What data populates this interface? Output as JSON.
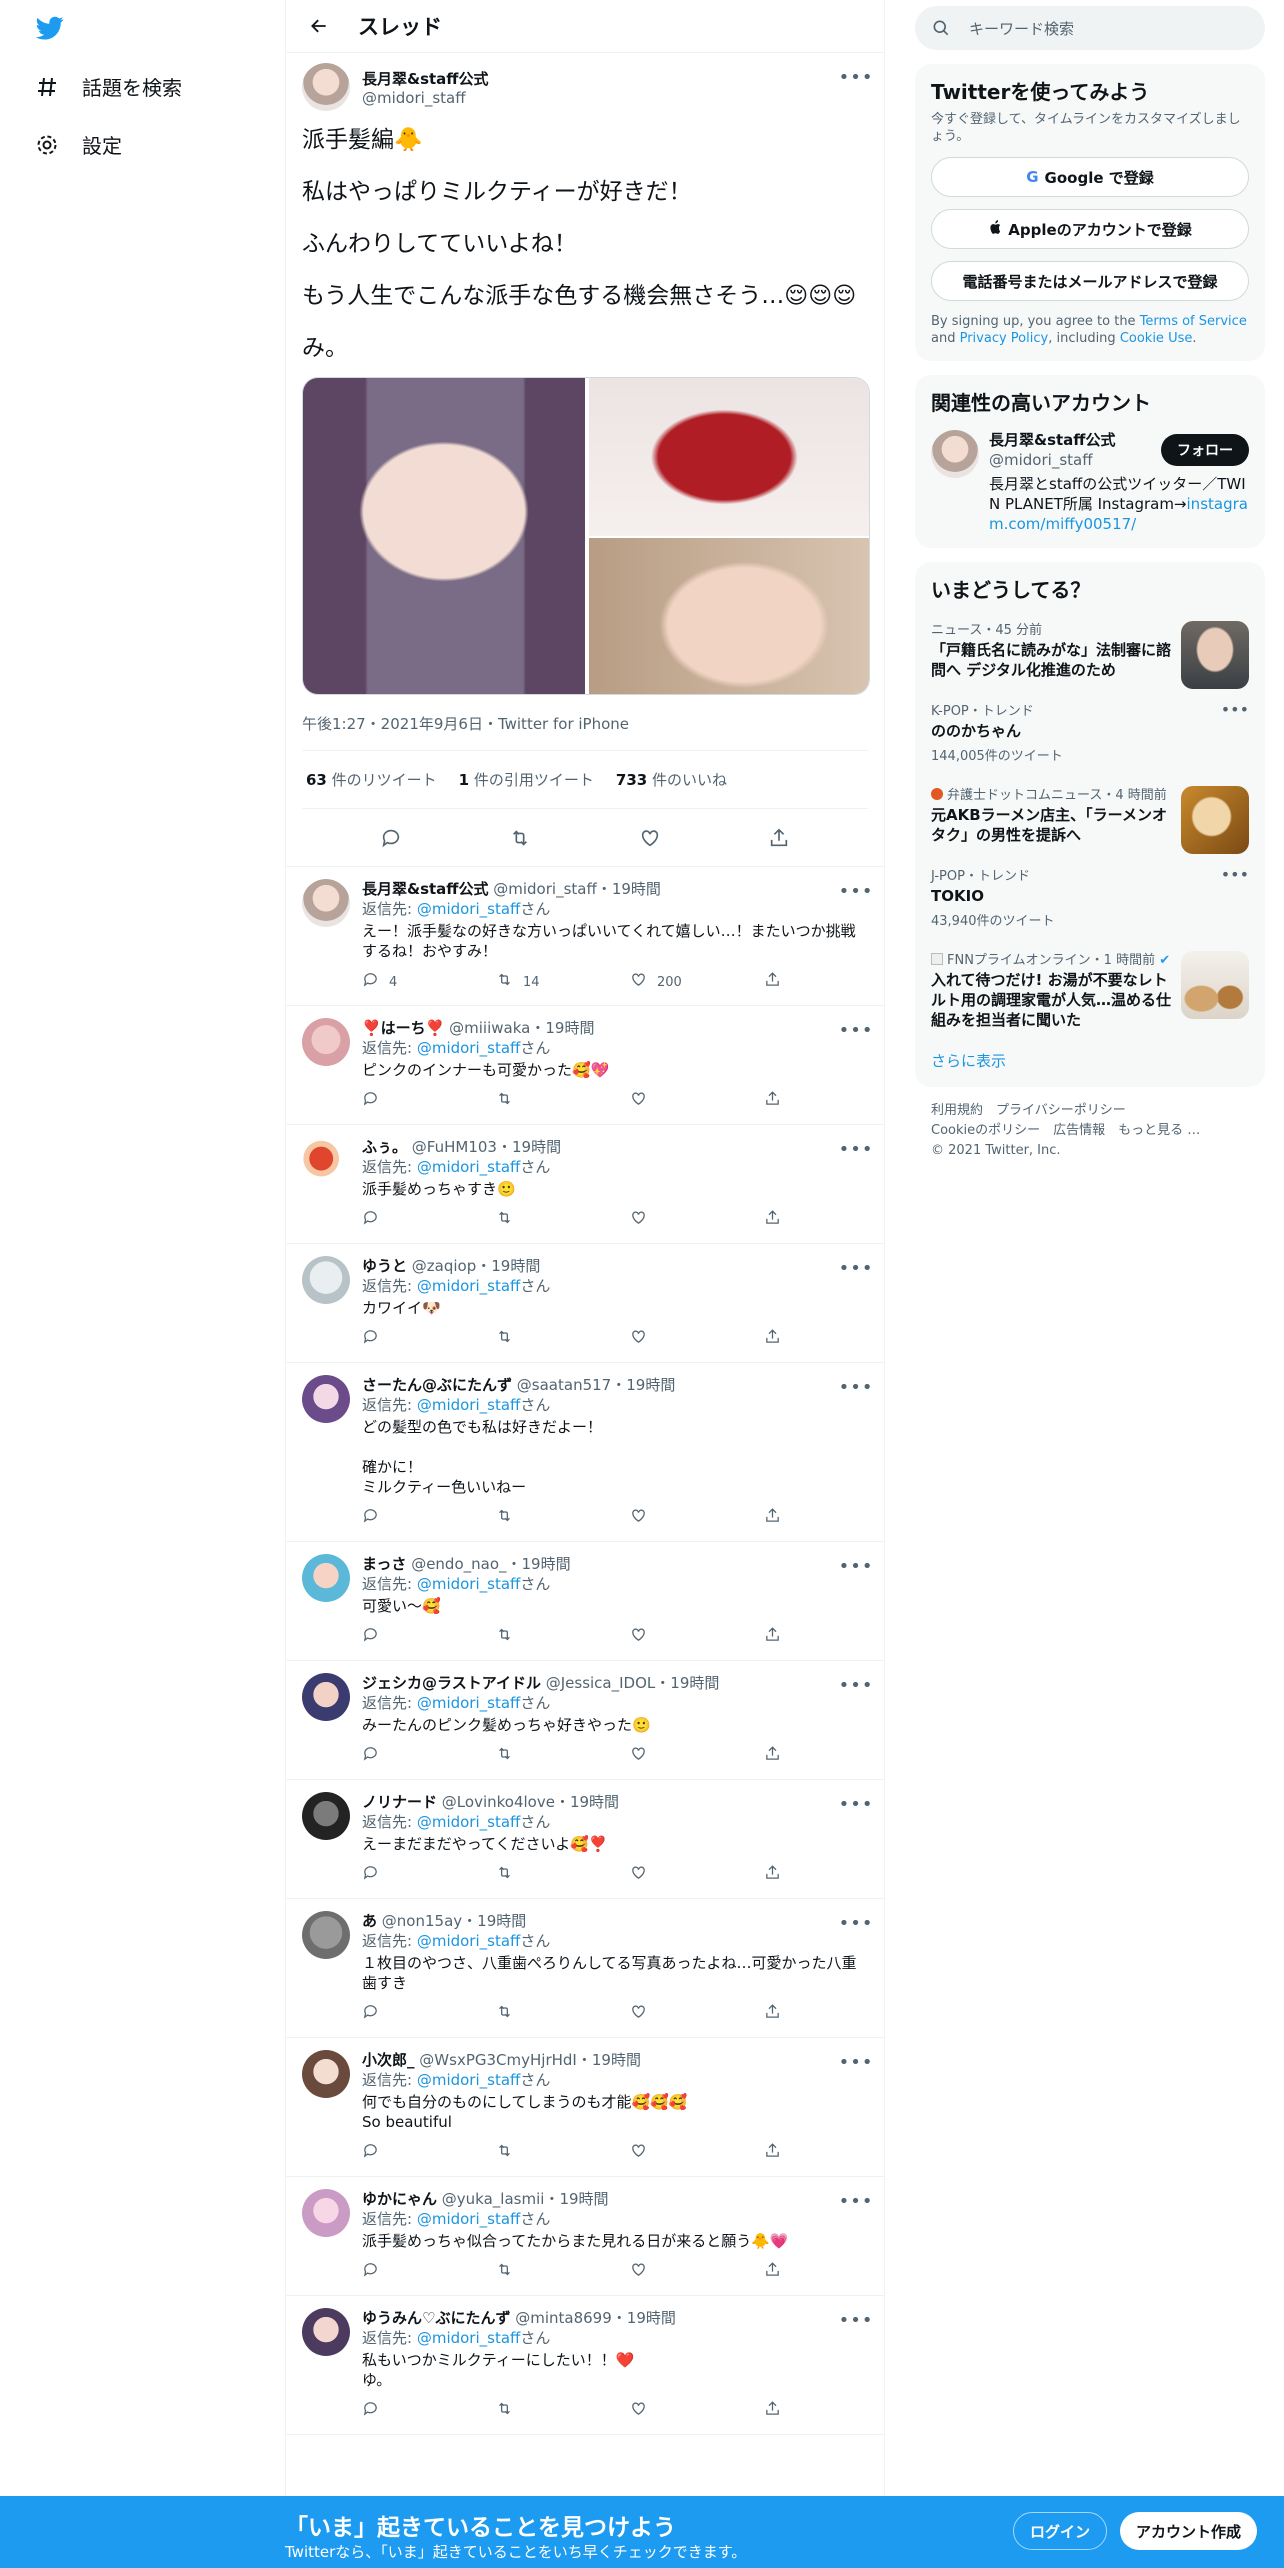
{
  "colors": {
    "accent": "#1d9bf0",
    "link": "#1b95e0",
    "text": "#0f1419",
    "muted": "#536471"
  },
  "nav": {
    "logo_icon": "twitter-bird-icon",
    "items": [
      {
        "icon": "hashtag-icon",
        "label": "話題を検索"
      },
      {
        "icon": "gear-icon",
        "label": "設定"
      }
    ]
  },
  "header": {
    "back_icon": "arrow-left-icon",
    "title": "スレッド"
  },
  "tweet": {
    "name": "長月翠&staff公式",
    "handle": "@midori_staff",
    "paragraphs": [
      "派手髪編🐥",
      "私はやっぱりミルクティーが好きだ！",
      "ふんわりしてていいよね！",
      "もう人生でこんな派手な色する機会無さそう…😌😌😌",
      "み。"
    ],
    "meta": "午後1:27・2021年9月6日・Twitter for iPhone",
    "retweets_num": "63",
    "retweets_label": "件のリツイート",
    "quotes_num": "1",
    "quotes_label": "件の引用ツイート",
    "likes_num": "733",
    "likes_label": "件のいいね"
  },
  "replies": [
    {
      "name": "長月翠&staff公式",
      "handle": "@midori_staff",
      "time": "19時間",
      "to_label": "返信先: ",
      "to_handle": "@midori_staff",
      "to_suffix": "さん",
      "text": "えー！派手髪なの好きな方いっぱいいてくれて嬉しい…！またいつか挑戦するね！おやすみ！",
      "replies": "4",
      "retweets": "14",
      "likes": "200"
    },
    {
      "name": "❣️はーち❣️",
      "handle": "@miiiwaka",
      "time": "19時間",
      "to_label": "返信先: ",
      "to_handle": "@midori_staff",
      "to_suffix": "さん",
      "text": "ピンクのインナーも可愛かった🥰💖",
      "replies": "",
      "retweets": "",
      "likes": ""
    },
    {
      "name": "ふぅ。",
      "handle": "@FuHM103",
      "time": "19時間",
      "to_label": "返信先: ",
      "to_handle": "@midori_staff",
      "to_suffix": "さん",
      "text": "派手髪めっちゃすき🙂",
      "replies": "",
      "retweets": "",
      "likes": ""
    },
    {
      "name": "ゆうと",
      "handle": "@zaqiop",
      "time": "19時間",
      "to_label": "返信先: ",
      "to_handle": "@midori_staff",
      "to_suffix": "さん",
      "text": "カワイイ🐶",
      "replies": "",
      "retweets": "",
      "likes": ""
    },
    {
      "name": "さーたん@ぶにたんず",
      "handle": "@saatan517",
      "time": "19時間",
      "to_label": "返信先: ",
      "to_handle": "@midori_staff",
      "to_suffix": "さん",
      "text": "どの髪型の色でも私は好きだよー！\n\n確かに！\nミルクティー色いいねー",
      "replies": "",
      "retweets": "",
      "likes": ""
    },
    {
      "name": "まっさ",
      "handle": "@endo_nao_",
      "time": "19時間",
      "to_label": "返信先: ",
      "to_handle": "@midori_staff",
      "to_suffix": "さん",
      "text": "可愛い〜🥰",
      "replies": "",
      "retweets": "",
      "likes": ""
    },
    {
      "name": "ジェシカ@ラストアイドル",
      "handle": "@Jessica_IDOL",
      "time": "19時間",
      "to_label": "返信先: ",
      "to_handle": "@midori_staff",
      "to_suffix": "さん",
      "text": "みーたんのピンク髪めっちゃ好きやった🙂",
      "replies": "",
      "retweets": "",
      "likes": ""
    },
    {
      "name": "ノリナード",
      "handle": "@Lovinko4love",
      "time": "19時間",
      "to_label": "返信先: ",
      "to_handle": "@midori_staff",
      "to_suffix": "さん",
      "text": "えーまだまだやってくださいよ🥰❣️",
      "replies": "",
      "retweets": "",
      "likes": ""
    },
    {
      "name": "あ",
      "handle": "@non15ay",
      "time": "19時間",
      "to_label": "返信先: ",
      "to_handle": "@midori_staff",
      "to_suffix": "さん",
      "text": "１枚目のやつさ、八重歯ぺろりんしてる写真あったよね…可愛かった八重歯すき",
      "replies": "",
      "retweets": "",
      "likes": ""
    },
    {
      "name": "小次郎_",
      "handle": "@WsxPG3CmyHjrHdI",
      "time": "19時間",
      "to_label": "返信先: ",
      "to_handle": "@midori_staff",
      "to_suffix": "さん",
      "text": "何でも自分のものにしてしまうのも才能🥰🥰🥰\nSo beautiful",
      "replies": "",
      "retweets": "",
      "likes": ""
    },
    {
      "name": "ゆかにゃん",
      "handle": "@yuka_lasmii",
      "time": "19時間",
      "to_label": "返信先: ",
      "to_handle": "@midori_staff",
      "to_suffix": "さん",
      "text": "派手髪めっちゃ似合ってたからまた見れる日が来ると願う🐥💗",
      "replies": "",
      "retweets": "",
      "likes": ""
    },
    {
      "name": "ゆうみん♡ぶにたんず",
      "handle": "@minta8699",
      "time": "19時間",
      "to_label": "返信先: ",
      "to_handle": "@midori_staff",
      "to_suffix": "さん",
      "text": "私もいつかミルクティーにしたい！！❤️\nゆ。",
      "replies": "",
      "retweets": "",
      "likes": ""
    }
  ],
  "search": {
    "placeholder": "キーワード検索"
  },
  "signup_card": {
    "title": "Twitterを使ってみよう",
    "subtitle": "今すぐ登録して、タイムラインをカスタマイズしましょう。",
    "google_btn": "Google で登録",
    "apple_btn": "Appleのアカウントで登録",
    "phone_btn": "電話番号またはメールアドレスで登録",
    "legal_pre": "By signing up, you agree to the ",
    "tos": "Terms of Service",
    "and": " and ",
    "privacy": "Privacy Policy",
    "including": ", including ",
    "cookie": "Cookie Use",
    "end": "."
  },
  "related": {
    "title": "関連性の高いアカウント",
    "name": "長月翠&staff公式",
    "handle": "@midori_staff",
    "bio": "長月翠とstaffの公式ツイッター／TWIN PLANET所属 Instagram→",
    "bio_link": "instagram.com/miffy00517/",
    "follow": "フォロー"
  },
  "trends": {
    "title": "いまどうしてる？",
    "items": [
      {
        "context": "ニュース・45 分前",
        "title": "「戸籍氏名に読みがな」法制審に諮問へ デジタル化推進のため",
        "count": ""
      },
      {
        "context": "K-POP・トレンド",
        "title": "ののかちゃん",
        "count": "144,005件のツイート"
      },
      {
        "context": "弁護士ドットコムニュース・4 時間前",
        "title": "元AKBラーメン店主、「ラーメンオタク」の男性を提訴へ",
        "count": ""
      },
      {
        "context": "J-POP・トレンド",
        "title": "TOKIO",
        "count": "43,940件のツイート"
      },
      {
        "context": "FNNプライムオンライン・1 時間前",
        "title": "入れて待つだけ! お湯が不要なレトルト用の調理家電が人気…温める仕組みを担当者に聞いた",
        "count": ""
      }
    ],
    "show_more": "さらに表示"
  },
  "footer": {
    "links1": "利用規約　プライバシーポリシー",
    "links2": "Cookieのポリシー　広告情報　もっと見る …",
    "copyright": "© 2021 Twitter, Inc."
  },
  "bottom_bar": {
    "title": "「いま」起きていることを見つけよう",
    "subtitle": "Twitterなら、「いま」起きていることをいち早くチェックできます。",
    "login": "ログイン",
    "signup": "アカウント作成"
  }
}
